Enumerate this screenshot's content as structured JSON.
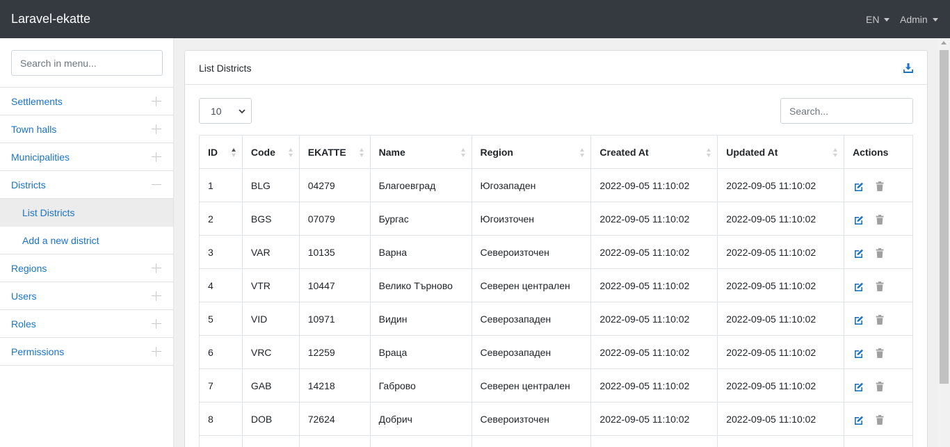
{
  "header": {
    "brand": "Laravel-ekatte",
    "language": "EN",
    "user": "Admin"
  },
  "sidebar": {
    "search_placeholder": "Search in menu...",
    "items": [
      {
        "label": "Settlements",
        "expanded": false
      },
      {
        "label": "Town halls",
        "expanded": false
      },
      {
        "label": "Municipalities",
        "expanded": false
      },
      {
        "label": "Districts",
        "expanded": true
      },
      {
        "label": "List Districts",
        "active": true
      },
      {
        "label": "Add a new district"
      },
      {
        "label": "Regions",
        "expanded": false
      },
      {
        "label": "Users",
        "expanded": false
      },
      {
        "label": "Roles",
        "expanded": false
      },
      {
        "label": "Permissions",
        "expanded": false
      }
    ]
  },
  "card": {
    "title": "List Districts",
    "page_size": "10",
    "search_placeholder": "Search..."
  },
  "table": {
    "columns": [
      "ID",
      "Code",
      "EKATTE",
      "Name",
      "Region",
      "Created At",
      "Updated At",
      "Actions"
    ],
    "rows": [
      [
        "1",
        "BLG",
        "04279",
        "Благоевград",
        "Югозападен",
        "2022-09-05 11:10:02",
        "2022-09-05 11:10:02"
      ],
      [
        "2",
        "BGS",
        "07079",
        "Бургас",
        "Югоизточен",
        "2022-09-05 11:10:02",
        "2022-09-05 11:10:02"
      ],
      [
        "3",
        "VAR",
        "10135",
        "Варна",
        "Североизточен",
        "2022-09-05 11:10:02",
        "2022-09-05 11:10:02"
      ],
      [
        "4",
        "VTR",
        "10447",
        "Велико Търново",
        "Северен централен",
        "2022-09-05 11:10:02",
        "2022-09-05 11:10:02"
      ],
      [
        "5",
        "VID",
        "10971",
        "Видин",
        "Северозападен",
        "2022-09-05 11:10:02",
        "2022-09-05 11:10:02"
      ],
      [
        "6",
        "VRC",
        "12259",
        "Враца",
        "Северозападен",
        "2022-09-05 11:10:02",
        "2022-09-05 11:10:02"
      ],
      [
        "7",
        "GAB",
        "14218",
        "Габрово",
        "Северен централен",
        "2022-09-05 11:10:02",
        "2022-09-05 11:10:02"
      ],
      [
        "8",
        "DOB",
        "72624",
        "Добрич",
        "Североизточен",
        "2022-09-05 11:10:02",
        "2022-09-05 11:10:02"
      ]
    ]
  },
  "colors": {
    "topbar": "#343a40",
    "link": "#1a73c8",
    "edit_icon": "#1a73c8",
    "delete_icon": "#a0a0a0"
  }
}
